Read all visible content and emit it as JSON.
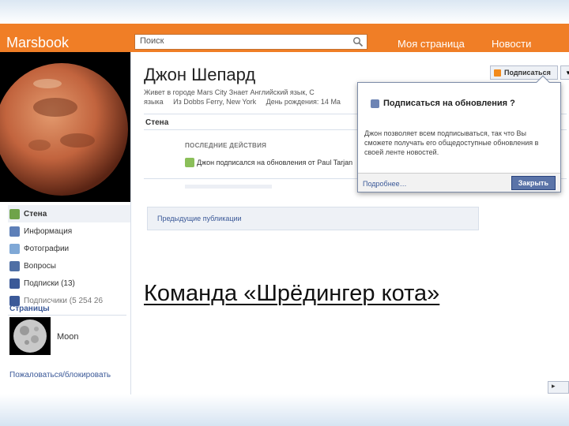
{
  "header": {
    "logo": "Marsbook",
    "search_placeholder": "Поиск",
    "nav": [
      "Моя страница",
      "Новости"
    ]
  },
  "profile": {
    "name": "Джон Шепард",
    "info_line1": "Живет в городе Mars City   Знает Английский язык, С",
    "info_lang": "языка",
    "hometown": "Из Dobbs Ferry, New York",
    "birthday": "День рождения: 14 Ma",
    "subscribe_button": "Подписаться",
    "more_button": "▾"
  },
  "wall": {
    "title": "Стена",
    "recent_title": "ПОСЛЕДНИЕ ДЕЙСТВИЯ",
    "recent_item": "Джон подписался на обновления от Paul Tarjan",
    "previous_posts": "Предыдущие публикации"
  },
  "sidebar": {
    "items": [
      {
        "label": "Стена",
        "icon": "wall-icon"
      },
      {
        "label": "Информация",
        "icon": "info-icon"
      },
      {
        "label": "Фотографии",
        "icon": "photos-icon"
      },
      {
        "label": "Вопросы",
        "icon": "questions-icon"
      },
      {
        "label": "Подписки (13)",
        "icon": "subscriptions-icon"
      },
      {
        "label": "Подписчики (5 254 26",
        "icon": "subscribers-icon"
      }
    ],
    "pages_title": "Страницы",
    "page_name": "Moon",
    "report_link": "Пожаловаться/блокировать"
  },
  "popup": {
    "title": "Подписаться на обновления ?",
    "text": "Джон позволяет всем подписываться, так что Вы сможете получать его общедоступные обновления в своей ленте новостей.",
    "more_link": "Подробнее…",
    "close_button": "Закрыть"
  },
  "caption": "Команда «Шрёдингер кота»",
  "chat_tab": "▸"
}
